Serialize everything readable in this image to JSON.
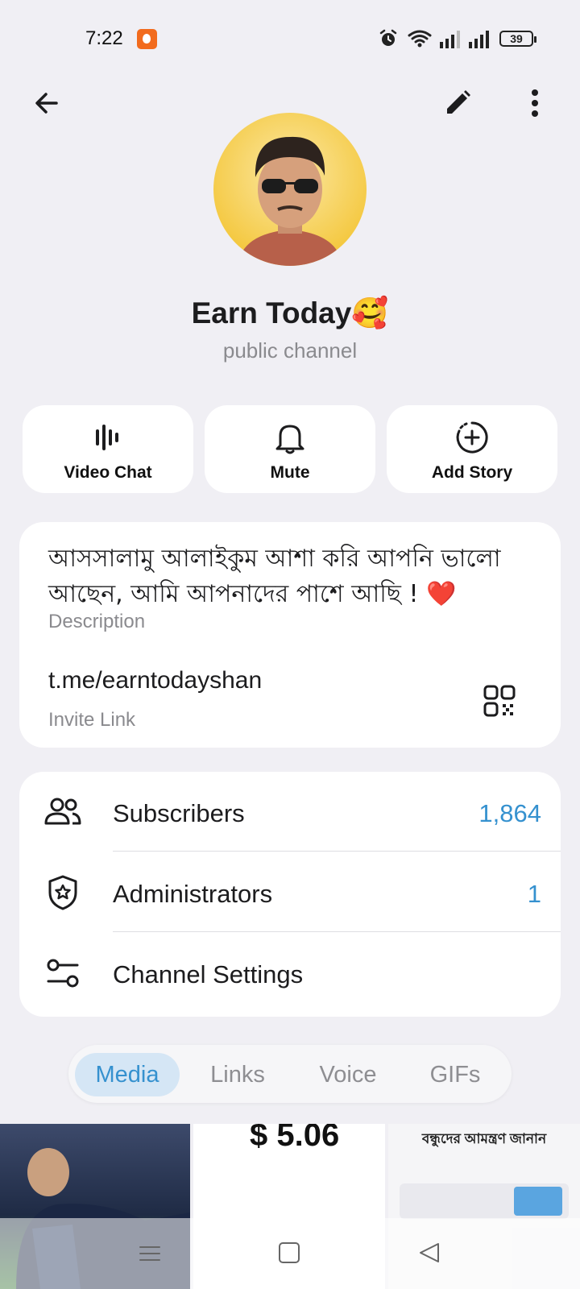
{
  "status_bar": {
    "time": "7:22",
    "battery": "39"
  },
  "header": {
    "channel_name": "Earn Today🥰",
    "channel_type": "public channel"
  },
  "actions": [
    {
      "label": "Video Chat",
      "icon": "video-chat-icon"
    },
    {
      "label": "Mute",
      "icon": "bell-icon"
    },
    {
      "label": "Add Story",
      "icon": "add-story-icon"
    }
  ],
  "info": {
    "description": "আসসালামু আলাইকুম আশা করি আপনি ভালো আছেন,  আমি আপনাদের পাশে আছি !",
    "description_emoji": "❤️",
    "description_label": "Description",
    "invite_link": "t.me/earntodayshan",
    "invite_link_label": "Invite Link"
  },
  "list": {
    "subscribers_label": "Subscribers",
    "subscribers_value": "1,864",
    "administrators_label": "Administrators",
    "administrators_value": "1",
    "settings_label": "Channel Settings"
  },
  "tabs": [
    "Media",
    "Links",
    "Voice",
    "GIFs"
  ],
  "media": {
    "price_preview": "$ 5.06",
    "invite_title": "বন্ধুদের আমন্ত্রণ জানান"
  },
  "colors": {
    "accent": "#3591cf",
    "background": "#f0eff4",
    "tab_active_bg": "#d5e6f5"
  }
}
